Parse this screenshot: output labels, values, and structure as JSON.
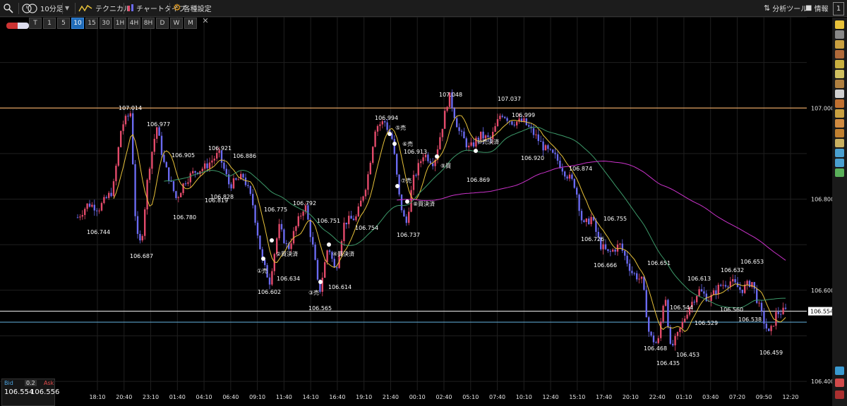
{
  "toolbar": {
    "timeframe_label": "10分足",
    "technical_label": "テクニカル",
    "chart_type_label": "チャートタイプ",
    "settings_label": "各種設定",
    "analysis_label": "分析ツール",
    "info_label": "情報",
    "window_number": "1"
  },
  "timeframes": [
    "T",
    "1",
    "5",
    "10",
    "15",
    "30",
    "1H",
    "4H",
    "8H",
    "D",
    "W",
    "M"
  ],
  "active_timeframe": "10",
  "prices": {
    "current": "106.554",
    "bid_label": "Bid",
    "ask_label": "Ask",
    "bid": "106.554",
    "ask": "106.556",
    "spread": "0.2"
  },
  "colors": {
    "ma_fast": "#e8c23a",
    "ma_mid": "#3d9a6a",
    "ma_slow": "#cc33cc",
    "resistance": "#e0a060",
    "support": "#5aa0c8",
    "bull": "#e34a6a",
    "bear": "#6a6af0"
  },
  "chart_data": {
    "type": "candlestick",
    "ylim": [
      106.38,
      107.2
    ],
    "y_ticks": [
      "107.000",
      "106.800",
      "106.600",
      "106.400"
    ],
    "x_ticks": [
      "18:10",
      "20:40",
      "23:10",
      "01:40",
      "04:10",
      "06:40",
      "09:10",
      "11:40",
      "14:10",
      "16:40",
      "19:10",
      "21:40",
      "00:10",
      "02:40",
      "05:10",
      "07:40",
      "10:10",
      "12:40",
      "15:10",
      "17:40",
      "20:10",
      "22:40",
      "01:10",
      "03:40",
      "07:20",
      "09:50",
      "12:20"
    ],
    "horizontal_lines": [
      {
        "value": 107.0,
        "color": "#e0a060"
      },
      {
        "value": 106.554,
        "color": "#cccccc"
      },
      {
        "value": 106.53,
        "color": "#5aa0c8"
      }
    ],
    "price_labels": [
      "107.014",
      "106.977",
      "106.744",
      "106.687",
      "106.905",
      "106.921",
      "106.886",
      "106.780",
      "106.819",
      "106.828",
      "106.775",
      "106.792",
      "106.751",
      "106.602",
      "106.634",
      "106.565",
      "106.614",
      "106.754",
      "106.994",
      "106.913",
      "106.737",
      "107.048",
      "106.869",
      "107.037",
      "106.999",
      "106.920",
      "106.874",
      "106.755",
      "106.726",
      "106.666",
      "106.651",
      "106.544",
      "106.468",
      "106.435",
      "106.453",
      "106.613",
      "106.529",
      "106.632",
      "106.560",
      "106.653",
      "106.538",
      "106.459"
    ],
    "trade_labels": [
      "①売",
      "②買決済",
      "③売",
      "④買決済",
      "⑤売",
      "⑥売",
      "⑦売",
      "⑧買決済",
      "⑨買",
      "⑩売決済"
    ]
  }
}
